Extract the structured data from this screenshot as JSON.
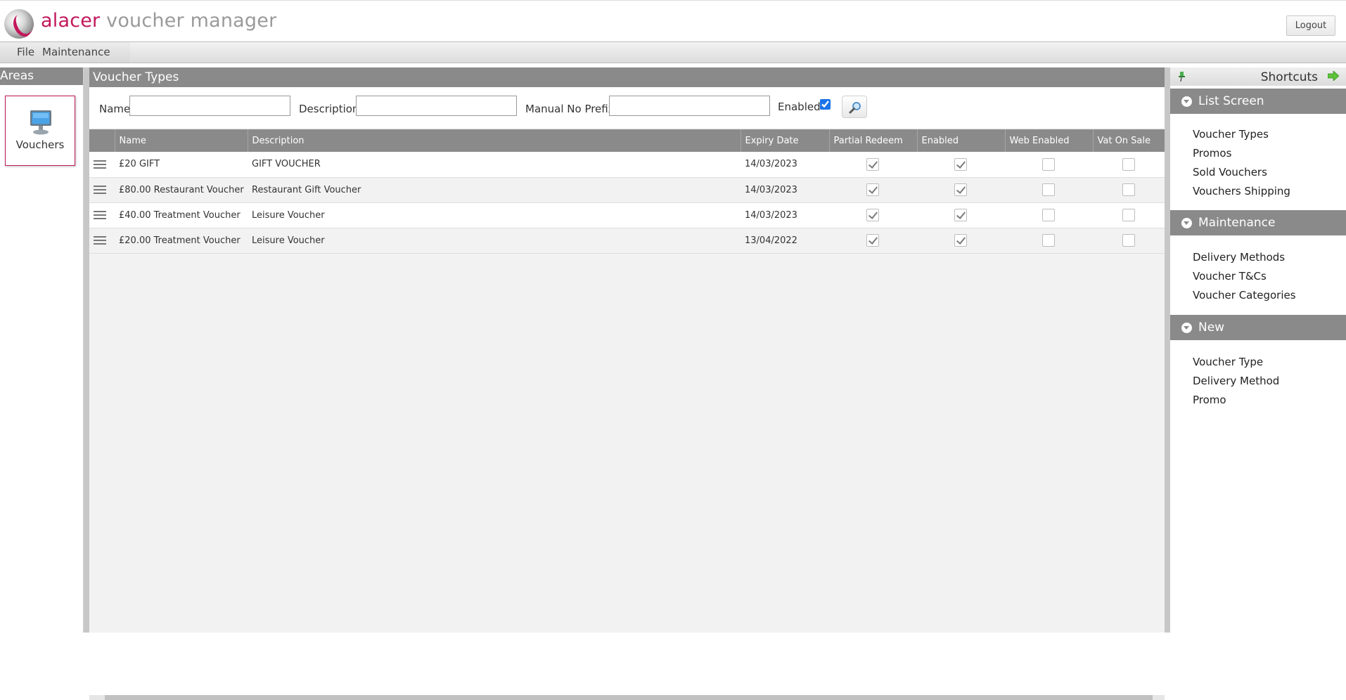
{
  "header": {
    "brand_primary": "alacer",
    "brand_secondary": "voucher manager",
    "logout_label": "Logout"
  },
  "menubar": {
    "items": [
      {
        "label": "File"
      },
      {
        "label": "Maintenance"
      }
    ]
  },
  "areas": {
    "title": "Areas",
    "tiles": [
      {
        "label": "Vouchers",
        "icon": "monitor-icon"
      }
    ]
  },
  "main": {
    "title": "Voucher Types",
    "filters": {
      "name_label": "Name",
      "name_value": "",
      "description_label": "Description",
      "description_value": "",
      "prefix_label": "Manual No Prefix",
      "prefix_value": "",
      "enabled_label": "Enabled",
      "enabled_checked": true,
      "search_icon": "magnifier-icon"
    },
    "table": {
      "columns": [
        "Name",
        "Description",
        "Expiry Date",
        "Partial Redeem",
        "Enabled",
        "Web Enabled",
        "Vat On Sale"
      ],
      "rows": [
        {
          "name": "£20 GIFT",
          "description": "GIFT VOUCHER",
          "expiry": "14/03/2023",
          "partial_redeem": true,
          "enabled": true,
          "web_enabled": false,
          "vat_on_sale": false
        },
        {
          "name": "£80.00 Restaurant Voucher",
          "description": "Restaurant Gift Voucher",
          "expiry": "14/03/2023",
          "partial_redeem": true,
          "enabled": true,
          "web_enabled": false,
          "vat_on_sale": false
        },
        {
          "name": "£40.00 Treatment Voucher",
          "description": "Leisure Voucher",
          "expiry": "14/03/2023",
          "partial_redeem": true,
          "enabled": true,
          "web_enabled": false,
          "vat_on_sale": false
        },
        {
          "name": "£20.00 Treatment Voucher",
          "description": "Leisure Voucher",
          "expiry": "13/04/2022",
          "partial_redeem": true,
          "enabled": true,
          "web_enabled": false,
          "vat_on_sale": false
        }
      ]
    }
  },
  "shortcuts": {
    "title": "Shortcuts",
    "sections": [
      {
        "title": "List Screen",
        "items": [
          "Voucher Types",
          "Promos",
          "Sold Vouchers",
          "Vouchers Shipping"
        ]
      },
      {
        "title": "Maintenance",
        "items": [
          "Delivery Methods",
          "Voucher T&Cs",
          "Voucher Categories"
        ]
      },
      {
        "title": "New",
        "items": [
          "Voucher Type",
          "Delivery Method",
          "Promo"
        ]
      }
    ]
  },
  "colors": {
    "brand": "#c2185b",
    "panel_header": "#8a8a8a",
    "checkbox_accent": "#1a73e8"
  }
}
